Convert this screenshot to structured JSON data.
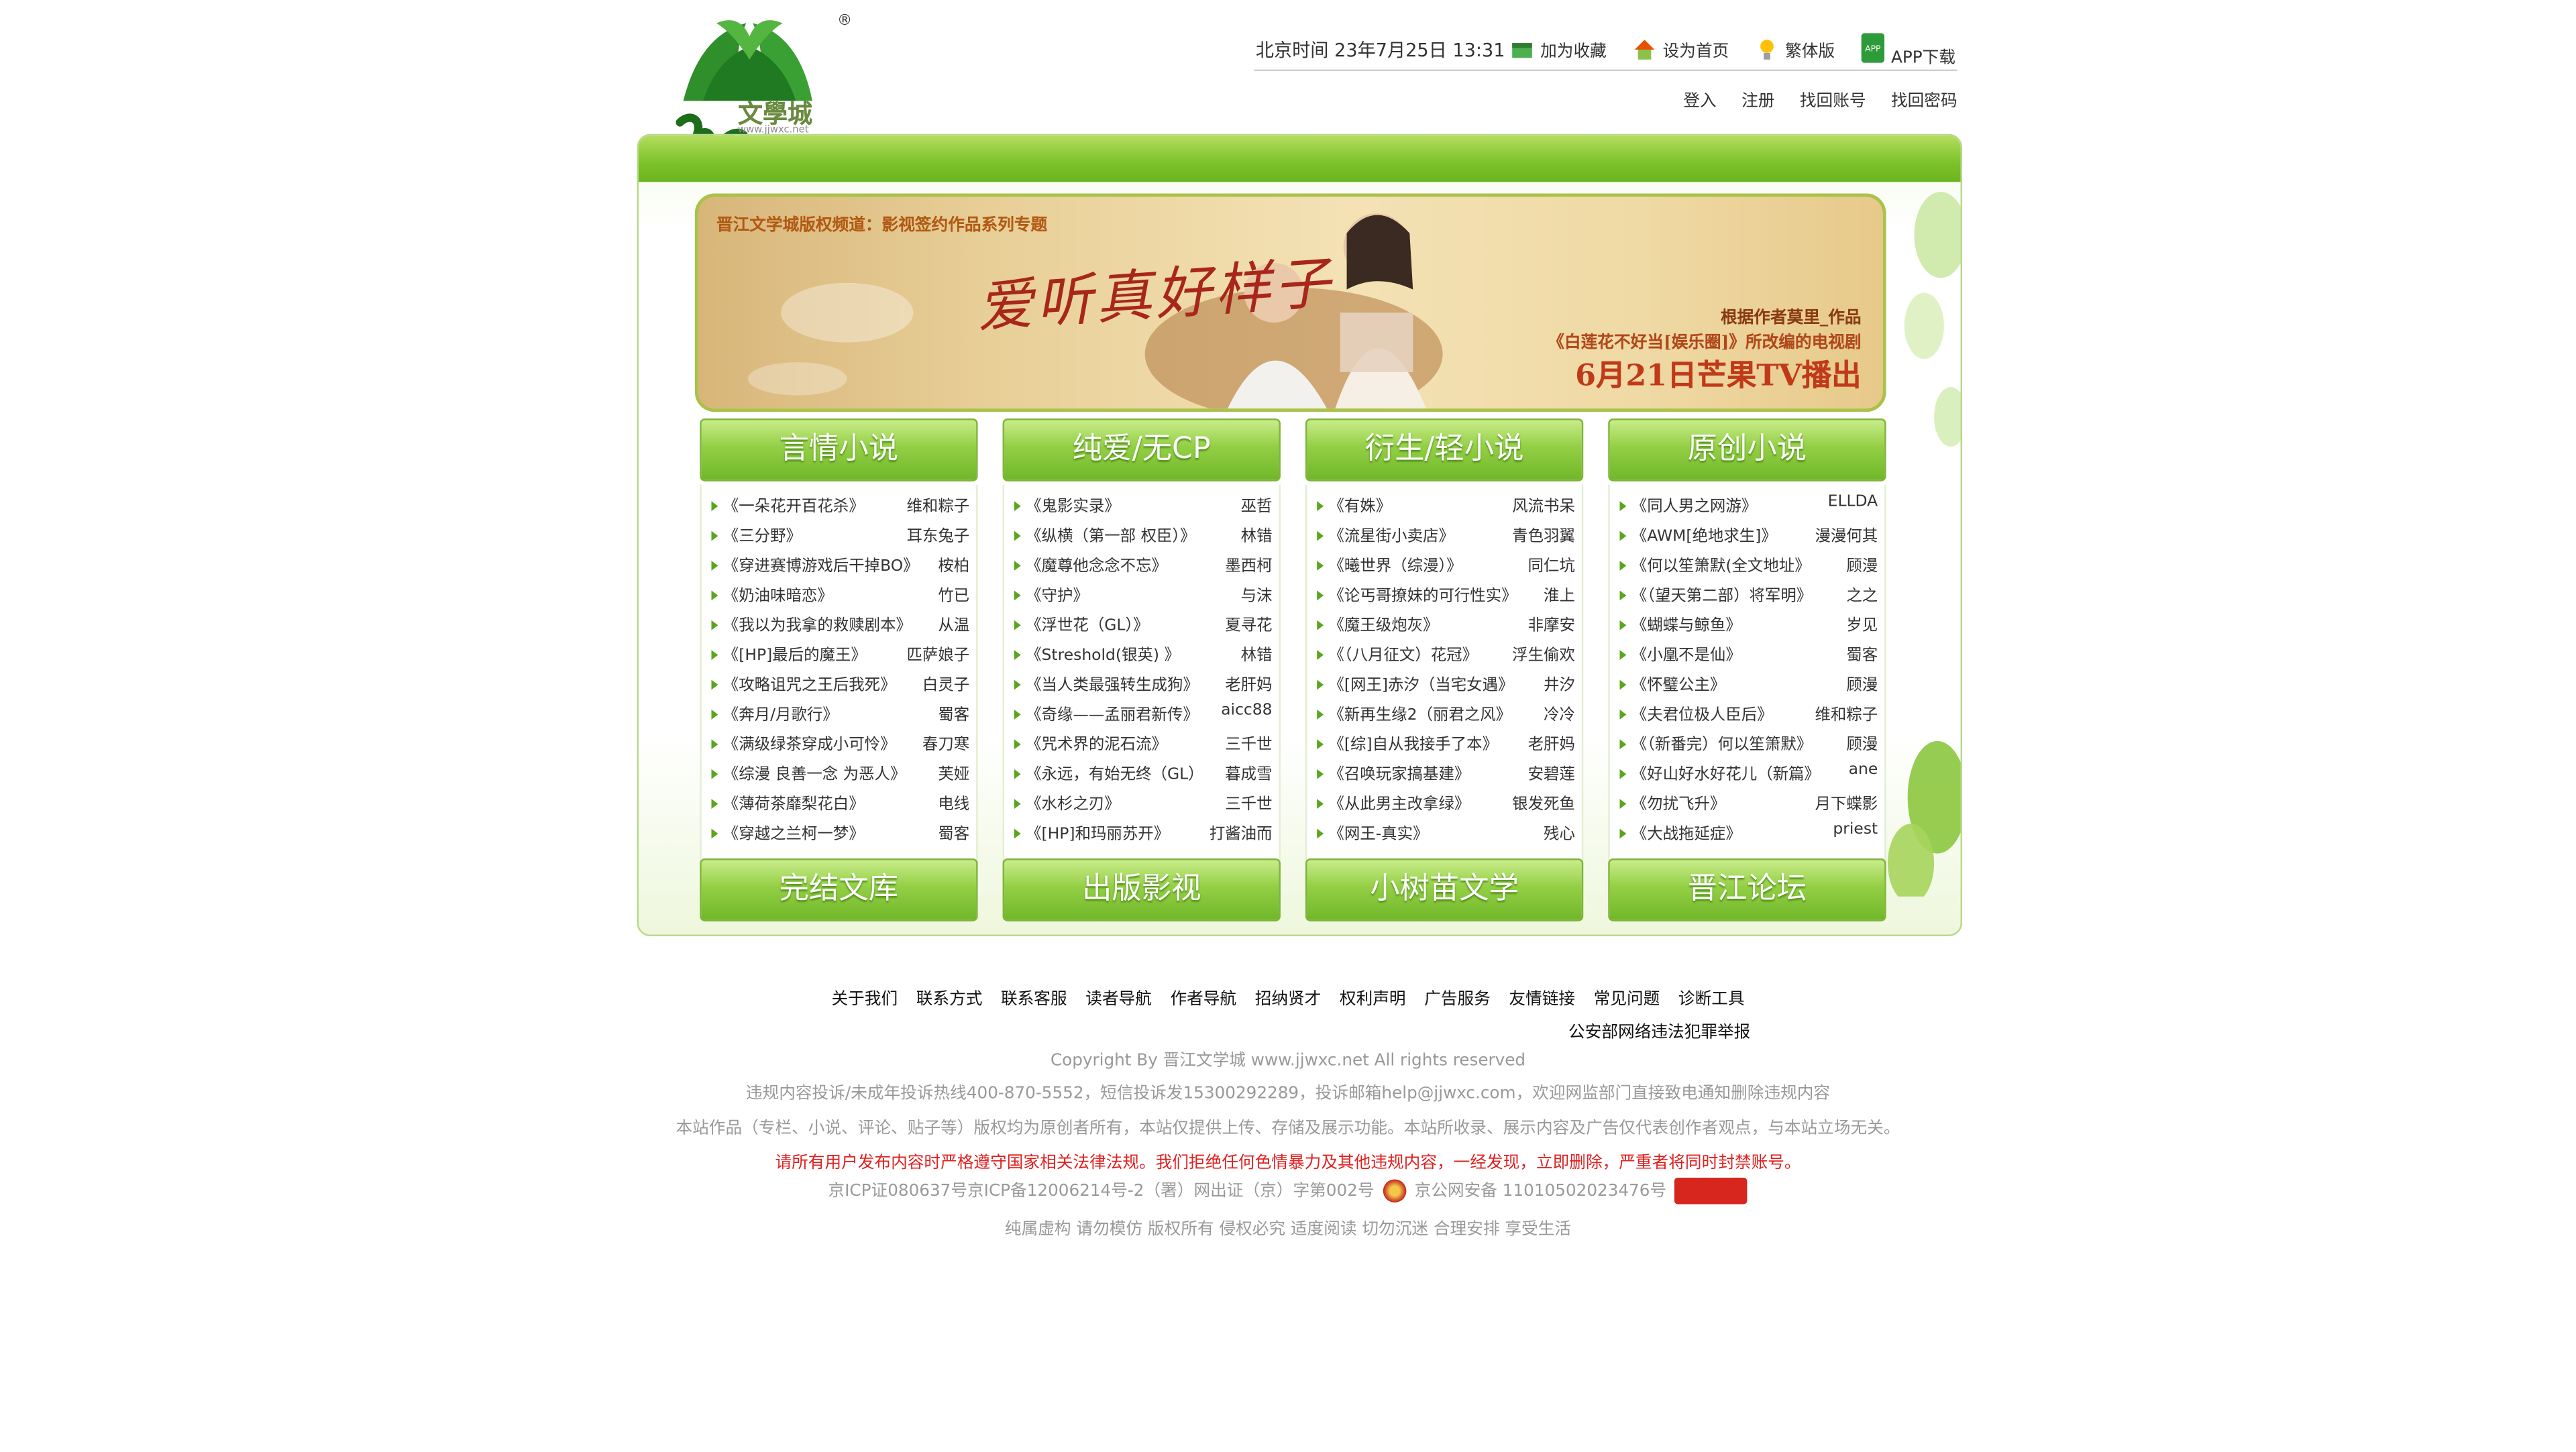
{
  "header": {
    "logo_text": "文學城",
    "logo_url": "www.jjwxc.net",
    "logo_mark": "®",
    "time_text": "北京时间 23年7月25日 13:31",
    "links": [
      {
        "label": "加为收藏",
        "icon": "bookmark-icon"
      },
      {
        "label": "设为首页",
        "icon": "home-icon"
      },
      {
        "label": "繁体版",
        "icon": "bulb-icon"
      },
      {
        "label": "APP下载",
        "icon": "app-icon"
      }
    ],
    "auth_links": [
      "登入",
      "注册",
      "找回账号",
      "找回密码"
    ]
  },
  "banner": {
    "title": "晋江文学城版权频道：影视签约作品系列专题",
    "script_text": "爱听真好样子",
    "line1": "根据作者莫里_作品",
    "line2": "《白莲花不好当[娱乐圈]》所改编的电视剧",
    "line3": "6月21日芒果TV播出"
  },
  "categories": [
    {
      "title": "言情小说",
      "items": [
        {
          "book": "《一朵花开百花杀》",
          "author": "维和粽子"
        },
        {
          "book": "《三分野》",
          "author": "耳东兔子"
        },
        {
          "book": "《穿进赛博游戏后干掉BO》",
          "author": "桉柏"
        },
        {
          "book": "《奶油味暗恋》",
          "author": "竹已"
        },
        {
          "book": "《我以为我拿的救赎剧本》",
          "author": "从温"
        },
        {
          "book": "《[HP]最后的魔王》",
          "author": "匹萨娘子"
        },
        {
          "book": "《攻略诅咒之王后我死》",
          "author": "白灵子"
        },
        {
          "book": "《奔月/月歌行》",
          "author": "蜀客"
        },
        {
          "book": "《满级绿茶穿成小可怜》",
          "author": "春刀寒"
        },
        {
          "book": "《综漫 良善一念 为恶人》",
          "author": "芙娅"
        },
        {
          "book": "《薄荷茶靡梨花白》",
          "author": "电线"
        },
        {
          "book": "《穿越之兰柯一梦》",
          "author": "蜀客"
        }
      ]
    },
    {
      "title": "纯爱/无CP",
      "items": [
        {
          "book": "《鬼影实录》",
          "author": "巫哲"
        },
        {
          "book": "《纵横（第一部 权臣）》",
          "author": "林错"
        },
        {
          "book": "《魔尊他念念不忘》",
          "author": "墨西柯"
        },
        {
          "book": "《守护》",
          "author": "与沫"
        },
        {
          "book": "《浮世花（GL）》",
          "author": "夏寻花"
        },
        {
          "book": "《Streshold(银英) 》",
          "author": "林错"
        },
        {
          "book": "《当人类最强转生成狗》",
          "author": "老肝妈"
        },
        {
          "book": "《奇缘——孟丽君新传》",
          "author": "aicc88"
        },
        {
          "book": "《咒术界的泥石流》",
          "author": "三千世"
        },
        {
          "book": "《永远，有始无终（GL）",
          "author": "暮成雪"
        },
        {
          "book": "《水杉之刃》",
          "author": "三千世"
        },
        {
          "book": "《[HP]和玛丽苏开》",
          "author": "打酱油而"
        }
      ]
    },
    {
      "title": "衍生/轻小说",
      "items": [
        {
          "book": "《有姝》",
          "author": "风流书呆"
        },
        {
          "book": "《流星街小卖店》",
          "author": "青色羽翼"
        },
        {
          "book": "《曦世界（综漫）》",
          "author": "同仁坑"
        },
        {
          "book": "《论丐哥撩妹的可行性实》",
          "author": "淮上"
        },
        {
          "book": "《魔王级炮灰》",
          "author": "非摩安"
        },
        {
          "book": "《（八月征文）花冠》",
          "author": "浮生偷欢"
        },
        {
          "book": "《[网王]赤汐（当宅女遇》",
          "author": "井汐"
        },
        {
          "book": "《新再生缘2（丽君之风》",
          "author": "冷冷"
        },
        {
          "book": "《[综]自从我接手了本》",
          "author": "老肝妈"
        },
        {
          "book": "《召唤玩家搞基建》",
          "author": "安碧莲"
        },
        {
          "book": "《从此男主改拿绿》",
          "author": "银发死鱼"
        },
        {
          "book": "《网王-真实》",
          "author": "残心"
        }
      ]
    },
    {
      "title": "原创小说",
      "items": [
        {
          "book": "《同人男之网游》",
          "author": "ELLDA"
        },
        {
          "book": "《AWM[绝地求生]》",
          "author": "漫漫何其"
        },
        {
          "book": "《何以笙箫默(全文地址》",
          "author": "顾漫"
        },
        {
          "book": "《（望天第二部）将军明》",
          "author": "之之"
        },
        {
          "book": "《蝴蝶与鲸鱼》",
          "author": "岁见"
        },
        {
          "book": "《小凰不是仙》",
          "author": "蜀客"
        },
        {
          "book": "《怀璧公主》",
          "author": "顾漫"
        },
        {
          "book": "《夫君位极人臣后》",
          "author": "维和粽子"
        },
        {
          "book": "《（新番完）何以笙箫默》",
          "author": "顾漫"
        },
        {
          "book": "《好山好水好花儿（新篇》",
          "author": "ane"
        },
        {
          "book": "《勿扰飞升》",
          "author": "月下蝶影"
        },
        {
          "book": "《大战拖延症》",
          "author": "priest"
        }
      ]
    }
  ],
  "bottom_buttons": [
    "完结文库",
    "出版影视",
    "小树苗文学",
    "晋江论坛"
  ],
  "footer": {
    "nav": [
      "关于我们",
      "联系方式",
      "联系客服",
      "读者导航",
      "作者导航",
      "招纳贤才",
      "权利声明",
      "广告服务",
      "友情链接",
      "常见问题",
      "诊断工具"
    ],
    "police_link": "公安部网络违法犯罪举报",
    "copyright": "Copyright By 晋江文学城 www.jjwxc.net All rights reserved",
    "hotline": "违规内容投诉/未成年投诉热线400-870-5552，短信投诉发15300292289，投诉邮箱help@jjwxc.com，欢迎网监部门直接致电通知删除违规内容",
    "disclaimer": "本站作品（专栏、小说、评论、贴子等）版权均为原创者所有，本站仅提供上传、存储及展示功能。本站所收录、展示内容及广告仅代表创作者观点，与本站立场无关。",
    "warning": "请所有用户发布内容时严格遵守国家相关法律法规。我们拒绝任何色情暴力及其他违规内容，一经发现，立即删除，严重者将同时封禁账号。",
    "icp_a": "京ICP证080637号京ICP备12006214号-2（署）网出证（京）字第002号",
    "icp_b": "京公网安备 11010502023476号",
    "slogan": "纯属虚构 请勿模仿 版权所有 侵权必究 适度阅读 切勿沉迷 合理安排 享受生活"
  },
  "colors": {
    "green": "#7cc22a",
    "red_notice": "#e02020",
    "muted": "#999999"
  }
}
